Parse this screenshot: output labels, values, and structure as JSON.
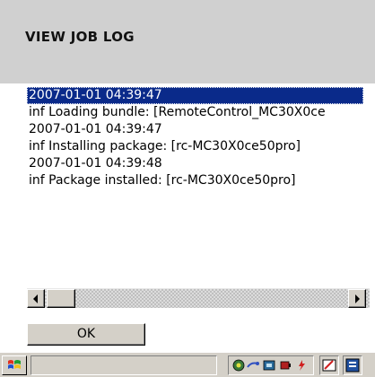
{
  "header": {
    "title": "VIEW JOB LOG"
  },
  "log": {
    "lines": [
      "2007-01-01 04:39:47",
      "inf Loading bundle: [RemoteControl_MC30X0ce",
      "2007-01-01 04:39:47",
      "inf Installing package: [rc-MC30X0ce50pro]",
      "2007-01-01 04:39:48",
      "inf Package installed: [rc-MC30X0ce50pro]"
    ],
    "selected_index": 0
  },
  "buttons": {
    "ok_label": "OK"
  },
  "taskbar": {
    "start_icon": "windows-flag-icon",
    "tray_icons": [
      "network-icon",
      "connection-icon",
      "sync-icon",
      "battery-power-icon",
      "pen-icon",
      "keyboard-icon"
    ]
  },
  "colors": {
    "header_bg": "#d0d0d0",
    "selection_bg": "#0a2a8a",
    "chrome_gray": "#d4d0c8"
  }
}
